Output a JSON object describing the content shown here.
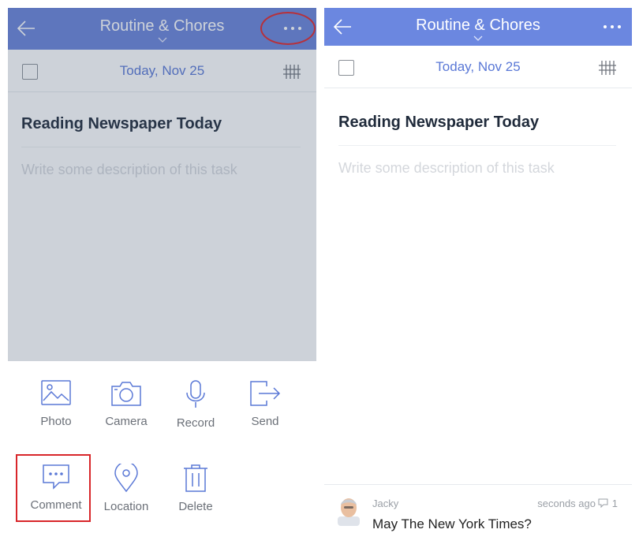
{
  "colors": {
    "header": "#6a83d9",
    "accent_date": "#5a78d6",
    "highlight": "#d8262a",
    "overlay": "rgba(62, 80, 110, 0.26)"
  },
  "left": {
    "header": {
      "title": "Routine & Chores",
      "back_icon": "arrow-left-icon",
      "more_icon": "ellipsis-icon"
    },
    "date_bar": {
      "date": "Today, Nov 25"
    },
    "task": {
      "title": "Reading Newspaper Today",
      "description_placeholder": "Write some description of this task"
    },
    "actions": {
      "photo": {
        "label": "Photo",
        "icon": "image-icon"
      },
      "camera": {
        "label": "Camera",
        "icon": "camera-icon"
      },
      "record": {
        "label": "Record",
        "icon": "microphone-icon"
      },
      "send": {
        "label": "Send",
        "icon": "share-icon"
      },
      "comment": {
        "label": "Comment",
        "icon": "comment-icon"
      },
      "location": {
        "label": "Location",
        "icon": "location-pin-icon"
      },
      "delete": {
        "label": "Delete",
        "icon": "trash-icon"
      }
    }
  },
  "right": {
    "header": {
      "title": "Routine & Chores"
    },
    "date_bar": {
      "date": "Today, Nov 25"
    },
    "task": {
      "title": "Reading Newspaper Today",
      "description_placeholder": "Write some description of this task"
    },
    "comment": {
      "author": "Jacky",
      "time": "seconds ago",
      "count": "1",
      "text": "May The New York Times?"
    }
  }
}
